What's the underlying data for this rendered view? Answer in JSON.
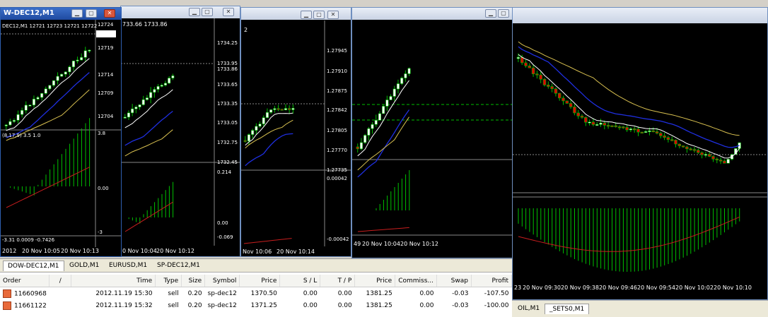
{
  "windows": {
    "w1": {
      "title": "W-DEC12,M1",
      "header": "DEC12,M1  12721 12723 12721 12722",
      "price_labels": [
        "12724",
        "12722",
        "12719",
        "12714",
        "12709",
        "12704"
      ],
      "indicator_label": "(8,17,9) 3.5 1.0",
      "ind_labels": [
        "3.8",
        "0.00",
        "-3"
      ],
      "time_labels": [
        "2012",
        "20 Nov 10:05",
        "20 Nov 10:13"
      ],
      "bottom_text": "-3.31 0.0009 -0.7426"
    },
    "w2": {
      "header": "733.66 1733.86",
      "price_labels": [
        "1734.25",
        "1733.95",
        "1733.86",
        "1733.65",
        "1733.35",
        "1733.05",
        "1732.75",
        "1732.45"
      ],
      "ind_labels": [
        "0.214",
        "0.00",
        "-0.069"
      ],
      "time_labels": [
        "0 Nov 10:04",
        "20 Nov 10:12"
      ]
    },
    "w3": {
      "header": "2",
      "price_labels": [
        "1.27945",
        "1.27910",
        "1.27875",
        "1.27842",
        "1.27805",
        "1.27770",
        "1.27735"
      ],
      "ind_labels": [
        "0.00042",
        "-0.00042"
      ],
      "time_labels": [
        "Nov 10:06",
        "20 Nov 10:14"
      ]
    },
    "w4": {
      "time_labels": [
        "49",
        "20 Nov 10:04",
        "20 Nov 10:12"
      ]
    },
    "w5": {
      "time_labels": [
        "23",
        "20 Nov 09:30",
        "20 Nov 09:38",
        "20 Nov 09:46",
        "20 Nov 09:54",
        "20 Nov 10:02",
        "20 Nov 10:10"
      ]
    }
  },
  "terminal": {
    "tabs": [
      "DOW-DEC12,M1",
      "GOLD,M1",
      "EURUSD,M1",
      "SP-DEC12,M1"
    ],
    "columns": [
      "Order",
      "/",
      "Time",
      "Type",
      "Size",
      "Symbol",
      "Price",
      "S / L",
      "T / P",
      "Price",
      "Commiss...",
      "Swap",
      "Profit"
    ],
    "rows": [
      [
        "11660968",
        "2012.11.19 15:30",
        "sell",
        "0.20",
        "sp-dec12",
        "1370.50",
        "0.00",
        "0.00",
        "1381.25",
        "0.00",
        "-0.03",
        "-107.50"
      ],
      [
        "11661122",
        "2012.11.19 15:32",
        "sell",
        "0.20",
        "sp-dec12",
        "1371.25",
        "0.00",
        "0.00",
        "1381.25",
        "0.00",
        "-0.03",
        "-100.00"
      ]
    ]
  },
  "rightbar_tabs": [
    "OIL,M1",
    "_SETS0,M1"
  ],
  "colors": {
    "bull": "#ffffff",
    "bear": "#e00000",
    "green": "#00c000",
    "ma_blue": "#1f2fe0",
    "ma_yellow": "#d8c050",
    "ma_white": "#ffffff",
    "signal_red": "#c81e1e"
  }
}
